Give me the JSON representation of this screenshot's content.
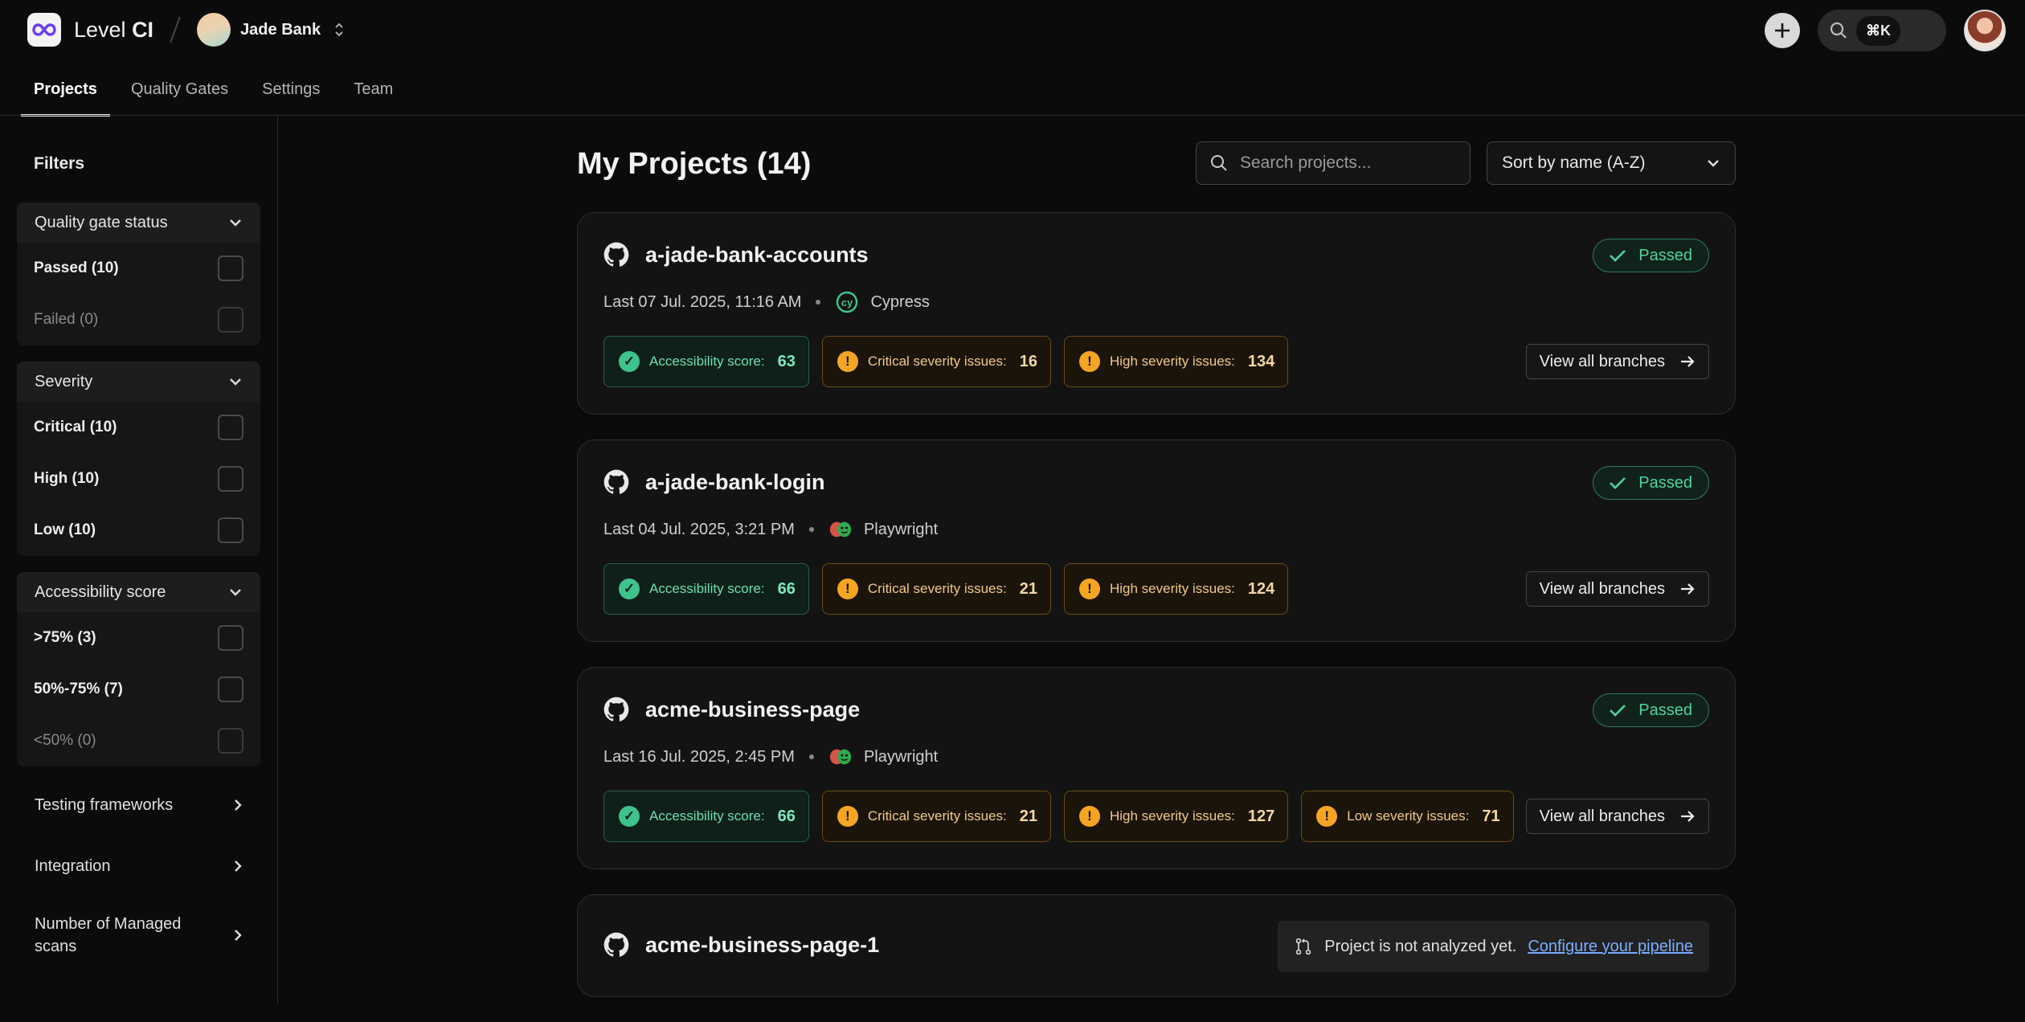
{
  "app": {
    "brand_light": "Level",
    "brand_bold": "CI"
  },
  "org": {
    "name": "Jade Bank"
  },
  "header": {
    "kbd_shortcut": "⌘K"
  },
  "tabs": [
    {
      "label": "Projects",
      "active": true
    },
    {
      "label": "Quality Gates"
    },
    {
      "label": "Settings"
    },
    {
      "label": "Team"
    }
  ],
  "sidebar": {
    "title": "Filters",
    "groups": [
      {
        "label": "Quality gate status",
        "options": [
          {
            "label": "Passed (10)"
          },
          {
            "label": "Failed (0)",
            "disabled": true
          }
        ]
      },
      {
        "label": "Severity",
        "options": [
          {
            "label": "Critical (10)"
          },
          {
            "label": "High (10)"
          },
          {
            "label": "Low (10)"
          }
        ]
      },
      {
        "label": "Accessibility score",
        "options": [
          {
            "label": ">75% (3)"
          },
          {
            "label": "50%-75% (7)"
          },
          {
            "label": "<50% (0)",
            "disabled": true
          }
        ]
      }
    ],
    "links": [
      {
        "label": "Testing frameworks"
      },
      {
        "label": "Integration"
      },
      {
        "label": "Number of Managed scans"
      }
    ]
  },
  "main": {
    "title": "My Projects (14)",
    "search_placeholder": "Search projects...",
    "sort_label": "Sort by name (A-Z)",
    "projects": [
      {
        "name": "a-jade-bank-accounts",
        "status": "Passed",
        "last_run": "Last 07 Jul. 2025, 11:16 AM",
        "framework": "Cypress",
        "metrics": [
          {
            "label": "Accessibility score:",
            "value": "63"
          },
          {
            "label": "Critical severity issues:",
            "value": "16"
          },
          {
            "label": "High severity issues:",
            "value": "134"
          }
        ],
        "branches_label": "View all branches"
      },
      {
        "name": "a-jade-bank-login",
        "status": "Passed",
        "last_run": "Last 04 Jul. 2025, 3:21 PM",
        "framework": "Playwright",
        "metrics": [
          {
            "label": "Accessibility score:",
            "value": "66"
          },
          {
            "label": "Critical severity issues:",
            "value": "21"
          },
          {
            "label": "High severity issues:",
            "value": "124"
          }
        ],
        "branches_label": "View all branches"
      },
      {
        "name": "acme-business-page",
        "status": "Passed",
        "last_run": "Last 16 Jul. 2025, 2:45 PM",
        "framework": "Playwright",
        "metrics": [
          {
            "label": "Accessibility score:",
            "value": "66"
          },
          {
            "label": "Critical severity issues:",
            "value": "21"
          },
          {
            "label": "High severity issues:",
            "value": "127"
          },
          {
            "label": "Low severity issues:",
            "value": "71"
          }
        ],
        "branches_label": "View all branches"
      },
      {
        "name": "acme-business-page-1",
        "not_analyzed_text": "Project is not analyzed yet.",
        "configure_link": "Configure your pipeline"
      }
    ]
  }
}
